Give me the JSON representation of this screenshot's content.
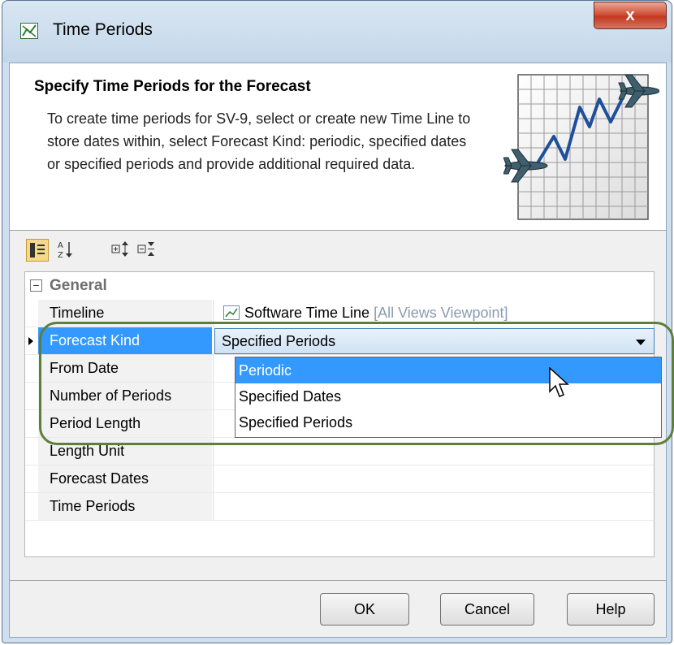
{
  "window": {
    "title": "Time Periods",
    "close_label": "x"
  },
  "header": {
    "title": "Specify Time Periods for the Forecast",
    "description": "To create time periods for SV-9, select or create new Time Line to store dates within, select Forecast Kind: periodic, specified dates or specified periods and provide additional required data.",
    "image_icon": "forecast-chart-airplanes-icon"
  },
  "toolbar": {
    "buttons": [
      {
        "icon": "categorized-view-icon",
        "selected": true
      },
      {
        "icon": "sort-alphabetical-icon",
        "selected": false
      },
      {
        "icon": "expand-all-icon",
        "selected": false
      },
      {
        "icon": "collapse-all-icon",
        "selected": false
      }
    ]
  },
  "properties": {
    "group": "General",
    "rows": [
      {
        "name": "Timeline",
        "value": "Software Time Line",
        "value_extra": "[All Views Viewpoint]"
      },
      {
        "name": "Forecast Kind",
        "value": "Specified Periods"
      },
      {
        "name": "From Date",
        "value": ""
      },
      {
        "name": "Number of Periods",
        "value": ""
      },
      {
        "name": "Period Length",
        "value": ""
      },
      {
        "name": "Length Unit",
        "value": ""
      },
      {
        "name": "Forecast Dates",
        "value": ""
      },
      {
        "name": "Time Periods",
        "value": ""
      }
    ]
  },
  "dropdown": {
    "options": [
      "Periodic",
      "Specified Dates",
      "Specified Periods"
    ],
    "highlighted": "Periodic"
  },
  "buttons": {
    "ok": "OK",
    "cancel": "Cancel",
    "help": "Help"
  },
  "colors": {
    "selection": "#3399ff",
    "highlight_ring": "#5f7e3c",
    "close_button": "#c2381f"
  }
}
